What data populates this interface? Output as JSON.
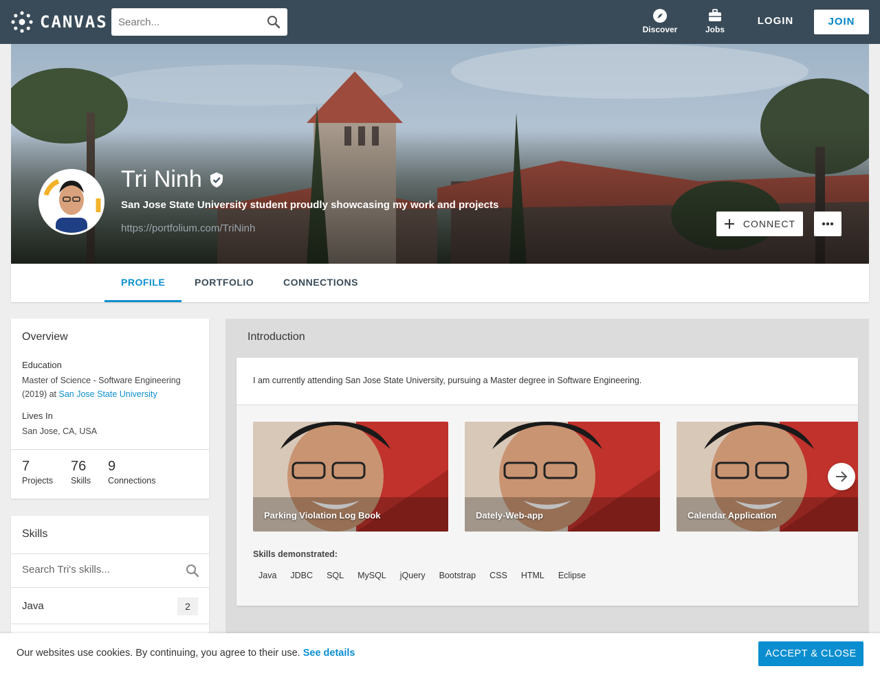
{
  "header": {
    "brand": "CANVAS",
    "search_placeholder": "Search...",
    "nav": [
      {
        "label": "Discover",
        "icon": "compass-icon"
      },
      {
        "label": "Jobs",
        "icon": "briefcase-icon"
      }
    ],
    "login_label": "LOGIN",
    "join_label": "JOIN"
  },
  "profile": {
    "name": "Tri Ninh",
    "verified_icon": "verified-badge-icon",
    "tagline": "San Jose State University student proudly showcasing my work and projects",
    "url": "https://portfolium.com/TriNinh",
    "connect_label": "CONNECT",
    "more_icon": "more-dots-icon"
  },
  "tabs": [
    {
      "label": "PROFILE",
      "active": true
    },
    {
      "label": "PORTFOLIO",
      "active": false
    },
    {
      "label": "CONNECTIONS",
      "active": false
    }
  ],
  "overview": {
    "title": "Overview",
    "education_label": "Education",
    "education_text": "Master of Science - Software Engineering (2019) at ",
    "education_school": "San Jose State University",
    "lives_label": "Lives In",
    "lives_text": "San Jose, CA, USA",
    "stats": [
      {
        "num": "7",
        "label": "Projects"
      },
      {
        "num": "76",
        "label": "Skills"
      },
      {
        "num": "9",
        "label": "Connections"
      }
    ]
  },
  "skills_card": {
    "title": "Skills",
    "search_placeholder": "Search Tri's skills...",
    "items": [
      {
        "name": "Java",
        "count": "2"
      }
    ]
  },
  "introduction": {
    "title": "Introduction",
    "text": "I am currently attending San Jose State University, pursuing a Master degree in Software Engineering.",
    "projects": [
      {
        "title": "Parking Violation Log Book"
      },
      {
        "title": "Dately-Web-app"
      },
      {
        "title": "Calendar Application"
      }
    ],
    "skills_label": "Skills demonstrated:",
    "skills": [
      "Java",
      "JDBC",
      "SQL",
      "MySQL",
      "jQuery",
      "Bootstrap",
      "CSS",
      "HTML",
      "Eclipse"
    ]
  },
  "cookie": {
    "text": "Our websites use cookies. By continuing, you agree to their use. ",
    "link": "See details",
    "accept_label": "ACCEPT & CLOSE"
  },
  "colors": {
    "header_bg": "#394b58",
    "accent": "#0a8ecf"
  }
}
